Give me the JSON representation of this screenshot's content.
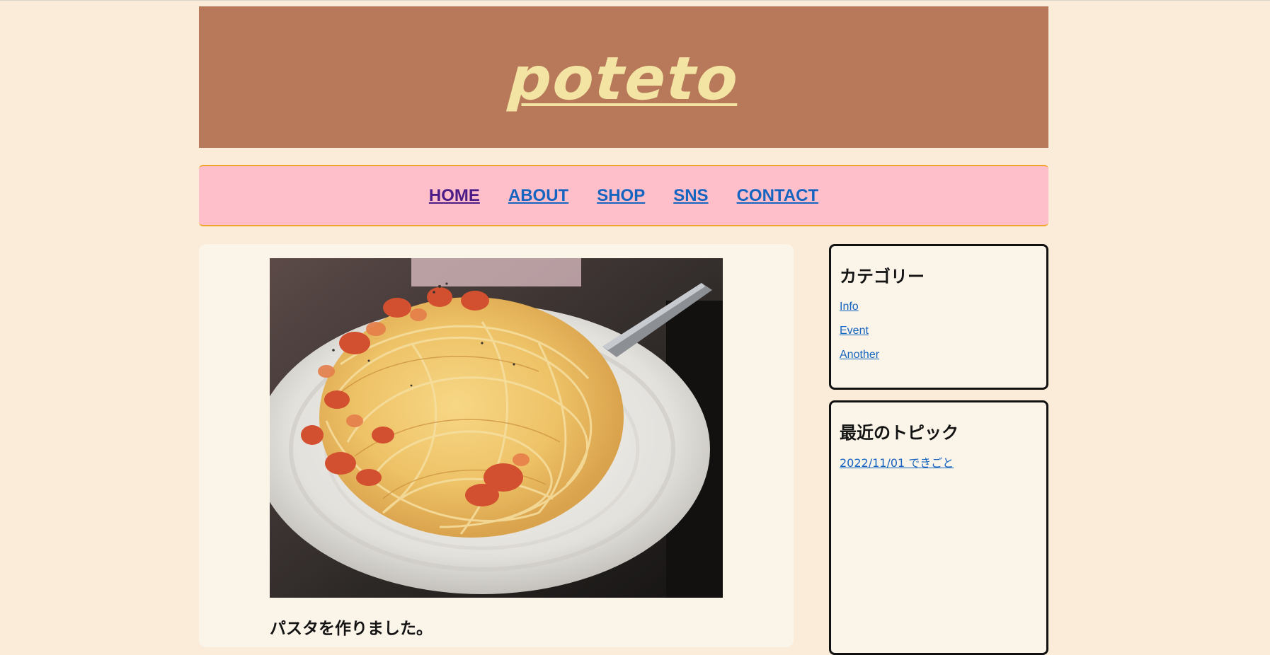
{
  "site": {
    "title": "poteto"
  },
  "nav": {
    "items": [
      {
        "label": "HOME"
      },
      {
        "label": "ABOUT"
      },
      {
        "label": "SHOP"
      },
      {
        "label": "SNS"
      },
      {
        "label": "CONTACT"
      }
    ]
  },
  "post": {
    "caption": "パスタを作りました。"
  },
  "sidebar": {
    "categories": {
      "heading": "カテゴリー",
      "links": [
        {
          "label": "Info"
        },
        {
          "label": "Event"
        },
        {
          "label": "Another"
        }
      ]
    },
    "recent_topics": {
      "heading": "最近のトピック",
      "links": [
        {
          "label": "2022/11/01 できごと"
        }
      ]
    }
  },
  "colors": {
    "page_background": "#fbebd9",
    "header_background": "#b8795a",
    "title_color": "#f3e4a4",
    "nav_background": "#ffbfca",
    "nav_border": "#f0a62c",
    "link_color": "#1565c0",
    "visited_link_color": "#4b1c86"
  }
}
